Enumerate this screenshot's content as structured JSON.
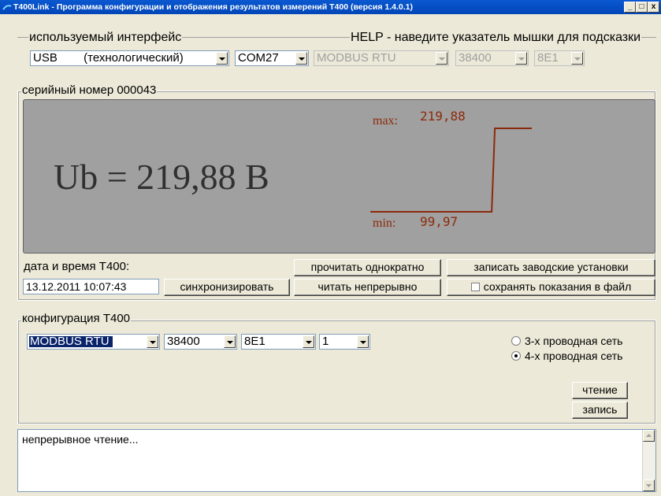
{
  "window": {
    "title": "T400Link - Программа конфигурации и отображения результатов измерений Т400 (версия 1.4.0.1)",
    "minimize": "_",
    "maximize": "□",
    "close": "x"
  },
  "interface": {
    "label": "используемый интерфейс",
    "help": "HELP - наведите указатель мышки для подсказки",
    "type": "USB        (технологический)",
    "port": "COM27",
    "protocol": "MODBUS RTU",
    "baud": "38400",
    "format": "8E1"
  },
  "measurement": {
    "serial_label": "серийный номер 000043",
    "value_text": "Ub = 219,88 В",
    "max_label": "max:",
    "max_value": "219,88",
    "min_label": "min:",
    "min_value": "99,97",
    "trend": [
      99.97,
      99.97,
      99.97,
      99.97,
      99.97,
      99.97,
      99.97,
      219.88,
      219.88,
      219.88
    ],
    "trend_color": "#8b2a0a",
    "display_bg": "#a0a0a0"
  },
  "datetime": {
    "label": "дата и время Т400:",
    "value": "13.12.2011 10:07:43",
    "sync_button": "синхронизировать"
  },
  "actions": {
    "read_once": "прочитать однократно",
    "read_continuous": "читать непрерывно",
    "write_factory": "записать заводские установки",
    "save_to_file": "сохранять показания в файл",
    "save_to_file_checked": false
  },
  "config": {
    "label": "конфигурация Т400",
    "protocol": "MODBUS RTU",
    "baud": "38400",
    "format": "8E1",
    "address": "1",
    "net3": "3-х проводная сеть",
    "net4": "4-х проводная сеть",
    "selected_net": "4-х проводная сеть",
    "read_button": "чтение",
    "write_button": "запись"
  },
  "log": {
    "text": "непрерывное чтение..."
  }
}
